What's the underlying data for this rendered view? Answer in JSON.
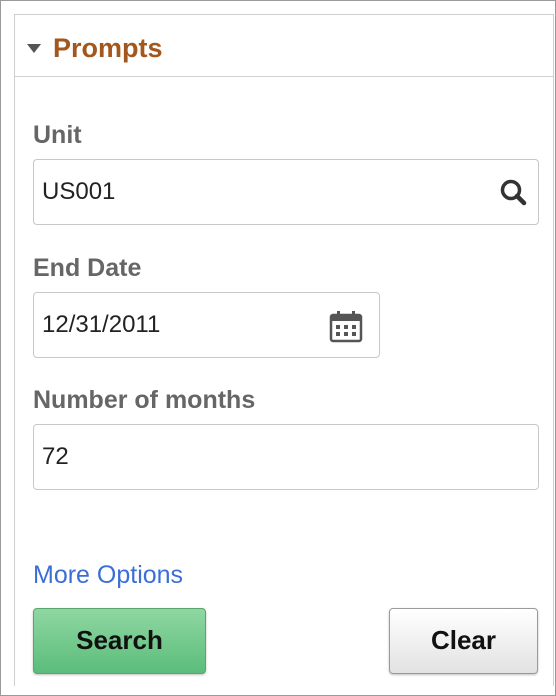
{
  "panel": {
    "title": "Prompts"
  },
  "fields": {
    "unit": {
      "label": "Unit",
      "value": "US001",
      "icon": "search-icon"
    },
    "end_date": {
      "label": "End Date",
      "value": "12/31/2011",
      "icon": "calendar-icon"
    },
    "months": {
      "label": "Number of months",
      "value": "72"
    }
  },
  "links": {
    "more_options": "More Options"
  },
  "buttons": {
    "search_label": "Search",
    "clear_label": "Clear"
  },
  "colors": {
    "title": "#a3571c",
    "link": "#3c6ed6",
    "search_button": "#6cc689",
    "label": "#666666"
  }
}
